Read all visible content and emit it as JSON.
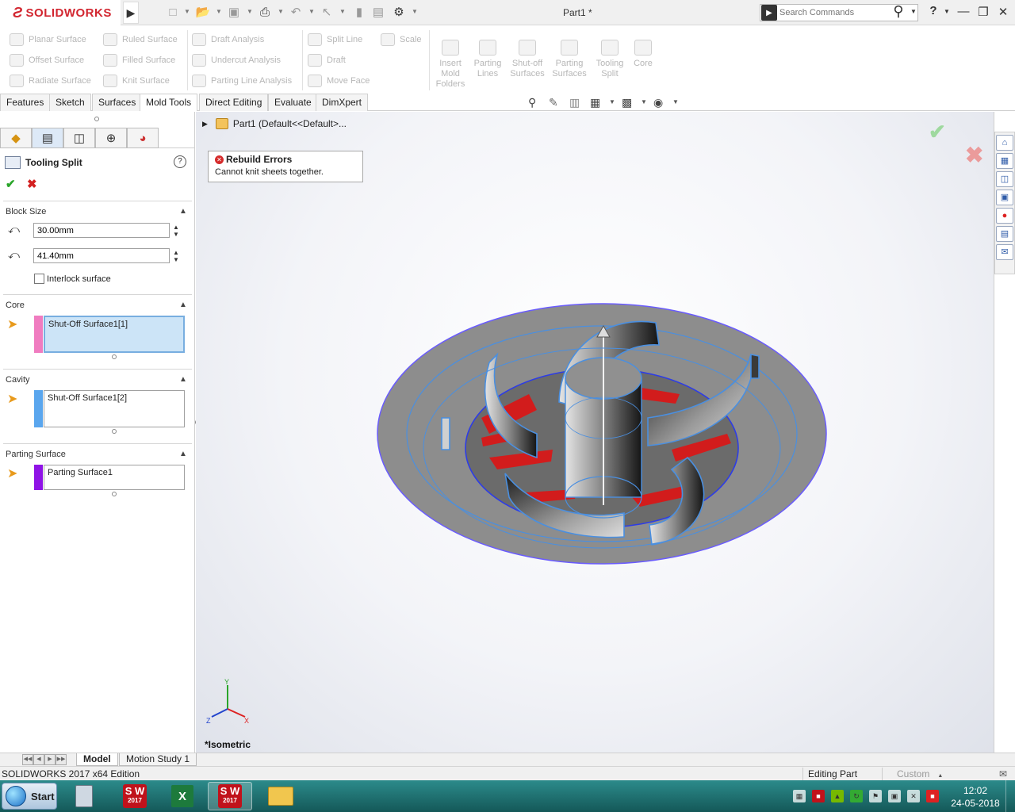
{
  "app": {
    "brand": "SOLIDWORKS",
    "doc_title": "Part1 *",
    "search_placeholder": "Search Commands",
    "help_label": "?"
  },
  "ribbon": {
    "col1": [
      "Planar Surface",
      "Offset Surface",
      "Radiate Surface"
    ],
    "col2": [
      "Ruled Surface",
      "Filled Surface",
      "Knit Surface"
    ],
    "col3": [
      "Draft Analysis",
      "Undercut Analysis",
      "Parting Line Analysis"
    ],
    "col4": [
      "Split Line",
      "Draft",
      "Move Face"
    ],
    "col5": [
      "Scale"
    ],
    "big": [
      {
        "l1": "Insert",
        "l2": "Mold",
        "l3": "Folders"
      },
      {
        "l1": "Parting",
        "l2": "Lines",
        "l3": ""
      },
      {
        "l1": "Shut-off",
        "l2": "Surfaces",
        "l3": ""
      },
      {
        "l1": "Parting",
        "l2": "Surfaces",
        "l3": ""
      },
      {
        "l1": "Tooling",
        "l2": "Split",
        "l3": ""
      },
      {
        "l1": "Core",
        "l2": "",
        "l3": ""
      }
    ]
  },
  "command_tabs": [
    "Features",
    "Sketch",
    "Surfaces",
    "Mold Tools",
    "Direct Editing",
    "Evaluate",
    "DimXpert"
  ],
  "property_manager": {
    "title": "Tooling Split",
    "help": "?",
    "block_size": {
      "header": "Block Size",
      "value1": "30.00mm",
      "value2": "41.40mm",
      "interlock_label": "Interlock surface",
      "interlock_checked": false
    },
    "core": {
      "header": "Core",
      "item": "Shut-Off Surface1[1]",
      "color": "#f07cc0"
    },
    "cavity": {
      "header": "Cavity",
      "item": "Shut-Off Surface1[2]",
      "color": "#5aa6ee"
    },
    "parting": {
      "header": "Parting Surface",
      "item": "Parting Surface1",
      "color": "#8f13e6"
    }
  },
  "viewport": {
    "tree_item": "Part1  (Default<<Default>...",
    "rebuild_title": "Rebuild Errors",
    "rebuild_message": "Cannot knit sheets together.",
    "view_name": "*Isometric",
    "triad": {
      "x": "X",
      "y": "Y",
      "z": "Z"
    }
  },
  "bottom_tabs": [
    "Model",
    "Motion Study 1"
  ],
  "status": {
    "edition": "SOLIDWORKS 2017 x64 Edition",
    "mode": "Editing Part",
    "units": "Custom"
  },
  "taskbar": {
    "start_label": "Start",
    "sw_label_top": "S W",
    "sw_label_year": "2017",
    "excel_label": "X",
    "time": "12:02",
    "date": "24-05-2018"
  },
  "colors": {
    "brand_red": "#d22630",
    "selection_blue": "#4a8fe0",
    "model_gray": "#8e8e8e",
    "error_red": "#d21c1c"
  }
}
